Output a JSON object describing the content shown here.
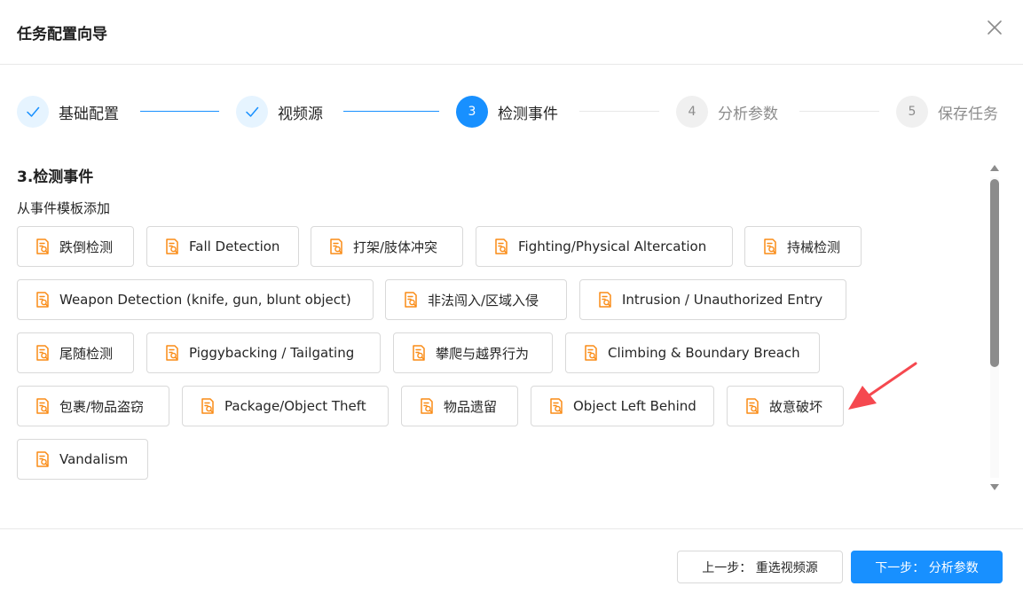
{
  "dialog": {
    "title": "任务配置向导",
    "close_icon": "close-icon"
  },
  "steps": [
    {
      "number": "1",
      "label": "基础配置",
      "status": "done"
    },
    {
      "number": "2",
      "label": "视频源",
      "status": "done"
    },
    {
      "number": "3",
      "label": "检测事件",
      "status": "active"
    },
    {
      "number": "4",
      "label": "分析参数",
      "status": "wait"
    },
    {
      "number": "5",
      "label": "保存任务",
      "status": "wait"
    }
  ],
  "section": {
    "title": "3.检测事件",
    "subtitle": "从事件模板添加"
  },
  "templates": [
    {
      "label": "跌倒检测",
      "icon": "document-search-icon"
    },
    {
      "label": "Fall Detection",
      "icon": "document-search-icon"
    },
    {
      "label": "打架/肢体冲突",
      "icon": "document-search-icon"
    },
    {
      "label": "Fighting/Physical Altercation",
      "icon": "document-search-icon"
    },
    {
      "label": "持械检测",
      "icon": "document-search-icon"
    },
    {
      "label": "Weapon Detection (knife, gun, blunt object)",
      "icon": "document-search-icon"
    },
    {
      "label": "非法闯入/区域入侵",
      "icon": "document-search-icon"
    },
    {
      "label": "Intrusion / Unauthorized Entry",
      "icon": "document-search-icon"
    },
    {
      "label": "尾随检测",
      "icon": "document-search-icon"
    },
    {
      "label": "Piggybacking / Tailgating",
      "icon": "document-search-icon"
    },
    {
      "label": "攀爬与越界行为",
      "icon": "document-search-icon"
    },
    {
      "label": "Climbing & Boundary Breach",
      "icon": "document-search-icon"
    },
    {
      "label": "包裹/物品盗窃",
      "icon": "document-search-icon"
    },
    {
      "label": "Package/Object Theft",
      "icon": "document-search-icon"
    },
    {
      "label": "物品遗留",
      "icon": "document-search-icon"
    },
    {
      "label": "Object Left Behind",
      "icon": "document-search-icon"
    },
    {
      "label": "故意破坏",
      "icon": "document-search-icon"
    },
    {
      "label": "Vandalism",
      "icon": "document-search-icon"
    }
  ],
  "footer": {
    "prev_label": "上一步：  重选视频源",
    "next_label": "下一步：  分析参数"
  },
  "colors": {
    "primary": "#1890ff",
    "primary_light": "#e6f4ff",
    "icon_orange": "#fa8c16",
    "annotation_arrow": "#f5484f"
  }
}
